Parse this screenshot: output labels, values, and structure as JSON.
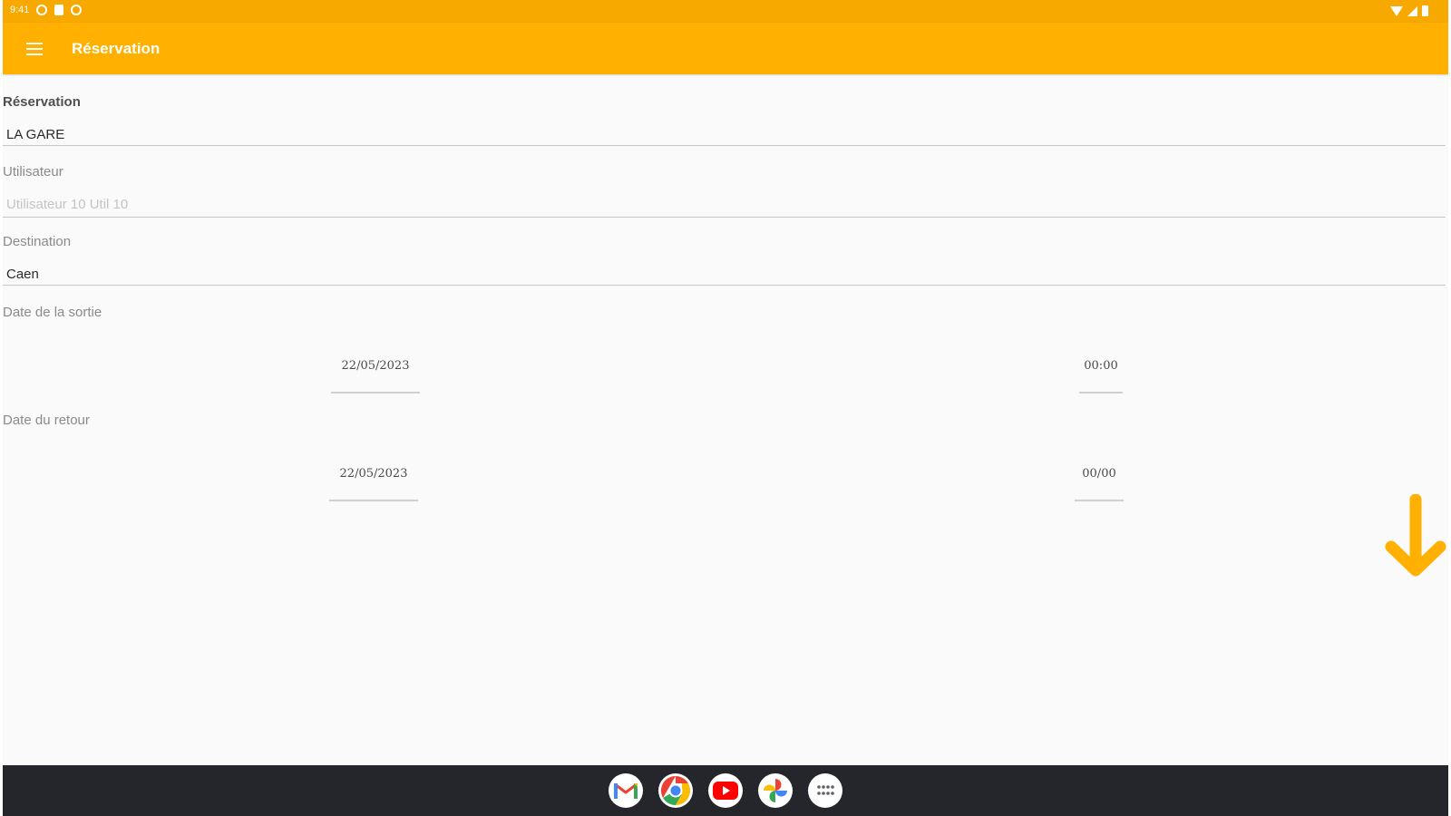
{
  "status_bar": {
    "time": "9:41"
  },
  "app_bar": {
    "title": "Réservation"
  },
  "form": {
    "reservation": {
      "label": "Réservation",
      "value": "LA GARE"
    },
    "utilisateur": {
      "label": "Utilisateur",
      "value": "Utilisateur 10 Util 10"
    },
    "destination": {
      "label": "Destination",
      "value": "Caen"
    },
    "date_sortie": {
      "label": "Date de la sortie",
      "date": "22/05/2023",
      "time": "00:00"
    },
    "date_retour": {
      "label": "Date du retour",
      "date": "22/05/2023",
      "time": "00/00"
    }
  },
  "taskbar": {
    "apps": [
      "gmail-icon",
      "chrome-icon",
      "youtube-icon",
      "photos-icon",
      "app-launcher-icon"
    ]
  },
  "colors": {
    "accent": "#ffb000",
    "status_bar": "#f7a900",
    "taskbar": "#24262b",
    "background": "#fafafa"
  }
}
